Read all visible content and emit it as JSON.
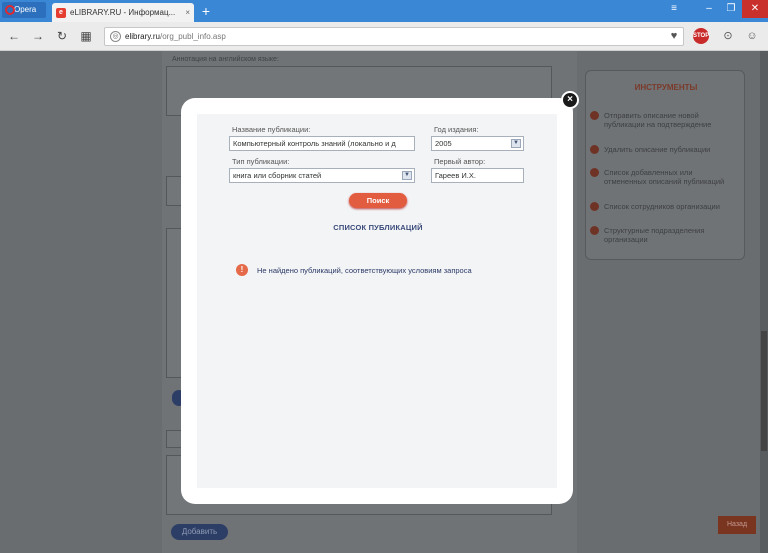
{
  "browser": {
    "menu_label": "Opera",
    "tab_title": "eLIBRARY.RU - Информац...",
    "tab_favicon": "e",
    "url_host": "elibrary.ru",
    "url_path": "/org_publ_info.asp"
  },
  "page": {
    "annotation_label": "Аннотация на английском языке:",
    "add_button": "Добавить",
    "back_button": "Назад",
    "tools": {
      "title": "ИНСТРУМЕНТЫ",
      "items": [
        "Отправить описание новой публикации на подтверждение",
        "Удалить описание публикации",
        "Список добавленных или отмененных описаний публикаций",
        "Список сотрудников организации",
        "Структурные подразделения организации"
      ]
    }
  },
  "modal": {
    "title_label": "Название публикации:",
    "title_value": "Компьютерный контроль знаний (локально и д",
    "year_label": "Год издания:",
    "year_value": "2005",
    "type_label": "Тип публикации:",
    "type_value": "книга или сборник статей",
    "author_label": "Первый автор:",
    "author_value": "Гареев И.Х.",
    "search_button": "Поиск",
    "list_link": "СПИСОК ПУБЛИКАЦИЙ",
    "not_found": "Не найдено публикаций, соответствующих условиям запроса"
  },
  "colors": {
    "accent": "#e25c3f",
    "link": "#3a4a7a",
    "titlebar": "#3a87d6"
  }
}
